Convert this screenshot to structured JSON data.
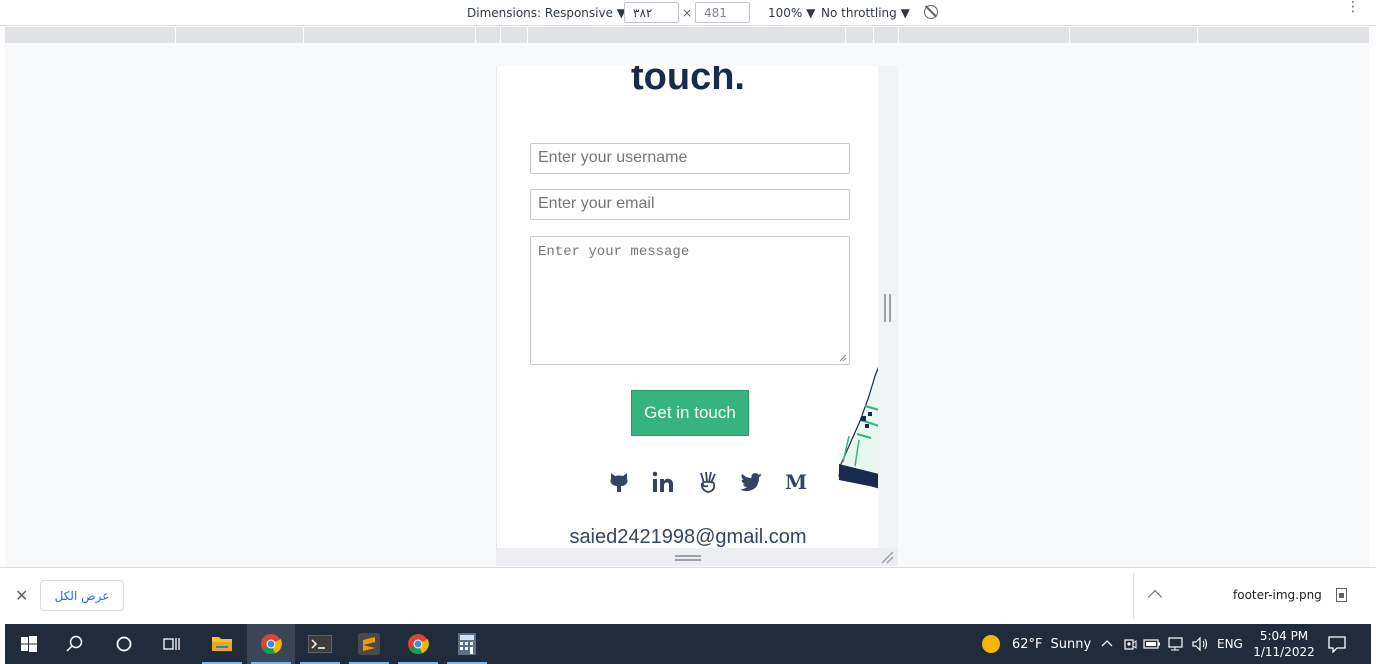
{
  "devtools": {
    "dimensions_label": "Dimensions: Responsive ▼",
    "width_value": "٣٨٢",
    "height_placeholder": "481",
    "times": "×",
    "zoom": "100% ▼",
    "throttling": "No throttling ▼",
    "more": "⋮"
  },
  "page": {
    "heading": "touch.",
    "username_placeholder": "Enter your username",
    "email_placeholder": "Enter your email",
    "message_placeholder": "Enter your message",
    "cta_label": "Get in touch",
    "social_icons": [
      "github-icon",
      "linkedin-icon",
      "angellist-icon",
      "twitter-icon",
      "medium-icon"
    ],
    "medium_letter": "M",
    "email": "saied2421998@gmail.com",
    "colors": {
      "heading": "#172b4d",
      "cta": "#36b37e",
      "icons": "#344563"
    }
  },
  "downloads": {
    "close": "✕",
    "show_all": "عرض الكل",
    "file_name": "footer-img.png"
  },
  "taskbar": {
    "weather_temp": "62°F",
    "weather_text": "Sunny",
    "lang": "ENG",
    "time": "5:04 PM",
    "date": "1/11/2022",
    "apps": [
      "windows-start-icon",
      "search-icon",
      "cortana-icon",
      "task-view-icon",
      "file-explorer-icon",
      "chrome-icon",
      "terminal-icon",
      "sublime-text-icon",
      "chrome-icon",
      "calculator-icon"
    ]
  }
}
